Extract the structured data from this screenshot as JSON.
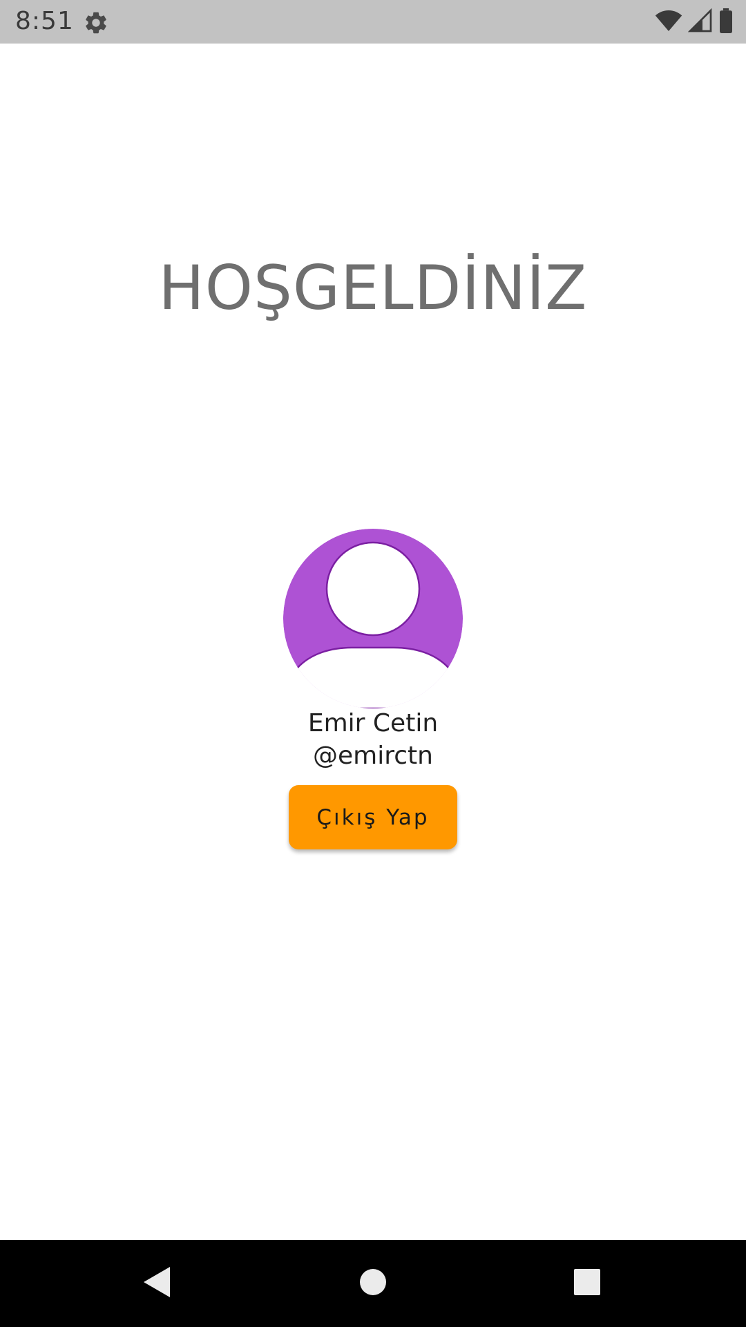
{
  "status_bar": {
    "time": "8:51",
    "icons": [
      "gear-icon",
      "wifi-icon",
      "signal-icon",
      "battery-icon"
    ],
    "background": "#c2c2c2"
  },
  "main": {
    "title": "HOŞGELDİNİZ",
    "user": {
      "name": "Emir Cetin",
      "handle": "@emirctn",
      "avatar_icon": "user-avatar-icon",
      "avatar_color": "#ae52d4"
    },
    "logout_button": {
      "label": "Çıkış Yap",
      "color": "#ff9800"
    }
  },
  "nav_bar": {
    "icons": [
      "back-icon",
      "home-icon",
      "recents-icon"
    ]
  }
}
